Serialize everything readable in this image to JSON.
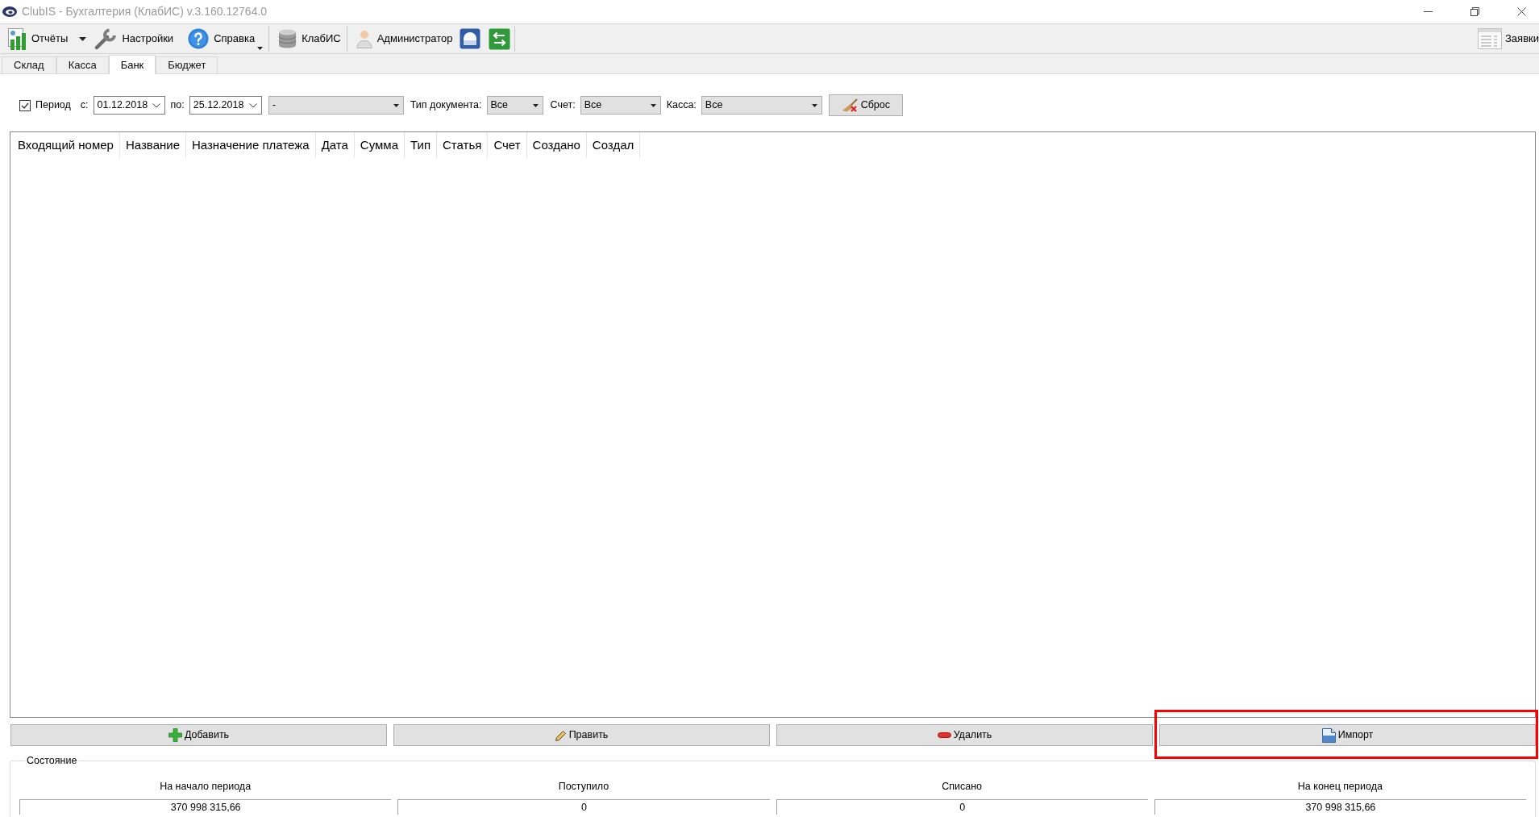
{
  "window": {
    "title": "ClubIS - Бухгалтерия (КлабИС) v.3.160.12764.0"
  },
  "toolbar": {
    "items": [
      {
        "label": "Отчёты",
        "kind": "dropdown"
      },
      {
        "label": "Настройки",
        "kind": "button"
      },
      {
        "label": "Справка",
        "kind": "split"
      },
      {
        "label": "КлабИС",
        "kind": "button"
      },
      {
        "label": "Администратор",
        "kind": "button"
      }
    ],
    "right_items": [
      {
        "label": "Заявки"
      }
    ]
  },
  "tabs": [
    {
      "label": "Склад",
      "selected": false
    },
    {
      "label": "Касса",
      "selected": false
    },
    {
      "label": "Банк",
      "selected": true
    },
    {
      "label": "Бюджет",
      "selected": false
    }
  ],
  "filters": {
    "period": {
      "label": "Период",
      "checked": true
    },
    "fields": [
      {
        "kind": "date",
        "label": "с:",
        "value": "01.12.2018"
      },
      {
        "kind": "date",
        "label": "по:",
        "value": "25.12.2018"
      },
      {
        "kind": "combo",
        "value": "-"
      },
      {
        "kind": "combo",
        "label": "Тип документа:",
        "value": "Все"
      },
      {
        "kind": "combo",
        "label": "Счет:",
        "value": "Все"
      },
      {
        "kind": "combo",
        "label": "Касса:",
        "value": "Все"
      }
    ],
    "reset_button": "Сброс"
  },
  "table": {
    "columns": [
      "Входящий номер",
      "Название",
      "Назначение платежа",
      "Дата",
      "Сумма",
      "Тип",
      "Статья",
      "Счет",
      "Создано",
      "Создал"
    ]
  },
  "buttons": [
    {
      "label": "Добавить",
      "kind": "add",
      "highlighted": false
    },
    {
      "label": "Править",
      "kind": "edit",
      "highlighted": false
    },
    {
      "label": "Удалить",
      "kind": "delete",
      "highlighted": false
    },
    {
      "label": "Импорт",
      "kind": "import",
      "highlighted": true
    }
  ],
  "status": {
    "title": "Состояние",
    "fields": [
      {
        "label": "На начало периода",
        "value": "370 998 315,66"
      },
      {
        "label": "Поступило",
        "value": "0"
      },
      {
        "label": "Списано",
        "value": "0"
      },
      {
        "label": "На конец периода",
        "value": "370 998 315,66"
      }
    ]
  }
}
